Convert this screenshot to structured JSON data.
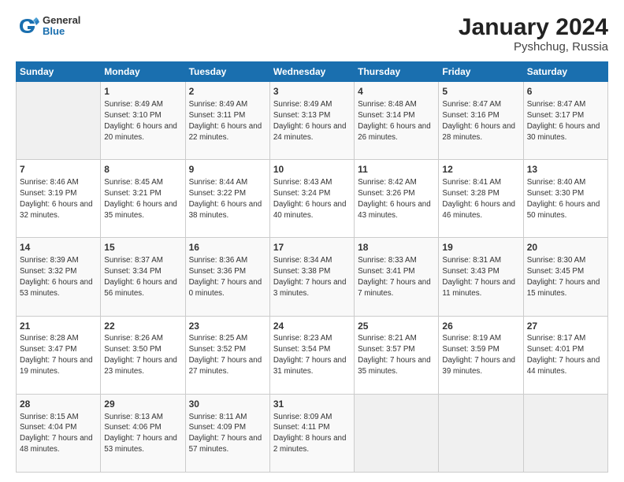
{
  "header": {
    "logo": {
      "line1": "General",
      "line2": "Blue"
    },
    "title": "January 2024",
    "subtitle": "Pyshchug, Russia"
  },
  "weekdays": [
    "Sunday",
    "Monday",
    "Tuesday",
    "Wednesday",
    "Thursday",
    "Friday",
    "Saturday"
  ],
  "weeks": [
    [
      {
        "day": "",
        "sunrise": "",
        "sunset": "",
        "daylight": ""
      },
      {
        "day": "1",
        "sunrise": "Sunrise: 8:49 AM",
        "sunset": "Sunset: 3:10 PM",
        "daylight": "Daylight: 6 hours and 20 minutes."
      },
      {
        "day": "2",
        "sunrise": "Sunrise: 8:49 AM",
        "sunset": "Sunset: 3:11 PM",
        "daylight": "Daylight: 6 hours and 22 minutes."
      },
      {
        "day": "3",
        "sunrise": "Sunrise: 8:49 AM",
        "sunset": "Sunset: 3:13 PM",
        "daylight": "Daylight: 6 hours and 24 minutes."
      },
      {
        "day": "4",
        "sunrise": "Sunrise: 8:48 AM",
        "sunset": "Sunset: 3:14 PM",
        "daylight": "Daylight: 6 hours and 26 minutes."
      },
      {
        "day": "5",
        "sunrise": "Sunrise: 8:47 AM",
        "sunset": "Sunset: 3:16 PM",
        "daylight": "Daylight: 6 hours and 28 minutes."
      },
      {
        "day": "6",
        "sunrise": "Sunrise: 8:47 AM",
        "sunset": "Sunset: 3:17 PM",
        "daylight": "Daylight: 6 hours and 30 minutes."
      }
    ],
    [
      {
        "day": "7",
        "sunrise": "Sunrise: 8:46 AM",
        "sunset": "Sunset: 3:19 PM",
        "daylight": "Daylight: 6 hours and 32 minutes."
      },
      {
        "day": "8",
        "sunrise": "Sunrise: 8:45 AM",
        "sunset": "Sunset: 3:21 PM",
        "daylight": "Daylight: 6 hours and 35 minutes."
      },
      {
        "day": "9",
        "sunrise": "Sunrise: 8:44 AM",
        "sunset": "Sunset: 3:22 PM",
        "daylight": "Daylight: 6 hours and 38 minutes."
      },
      {
        "day": "10",
        "sunrise": "Sunrise: 8:43 AM",
        "sunset": "Sunset: 3:24 PM",
        "daylight": "Daylight: 6 hours and 40 minutes."
      },
      {
        "day": "11",
        "sunrise": "Sunrise: 8:42 AM",
        "sunset": "Sunset: 3:26 PM",
        "daylight": "Daylight: 6 hours and 43 minutes."
      },
      {
        "day": "12",
        "sunrise": "Sunrise: 8:41 AM",
        "sunset": "Sunset: 3:28 PM",
        "daylight": "Daylight: 6 hours and 46 minutes."
      },
      {
        "day": "13",
        "sunrise": "Sunrise: 8:40 AM",
        "sunset": "Sunset: 3:30 PM",
        "daylight": "Daylight: 6 hours and 50 minutes."
      }
    ],
    [
      {
        "day": "14",
        "sunrise": "Sunrise: 8:39 AM",
        "sunset": "Sunset: 3:32 PM",
        "daylight": "Daylight: 6 hours and 53 minutes."
      },
      {
        "day": "15",
        "sunrise": "Sunrise: 8:37 AM",
        "sunset": "Sunset: 3:34 PM",
        "daylight": "Daylight: 6 hours and 56 minutes."
      },
      {
        "day": "16",
        "sunrise": "Sunrise: 8:36 AM",
        "sunset": "Sunset: 3:36 PM",
        "daylight": "Daylight: 7 hours and 0 minutes."
      },
      {
        "day": "17",
        "sunrise": "Sunrise: 8:34 AM",
        "sunset": "Sunset: 3:38 PM",
        "daylight": "Daylight: 7 hours and 3 minutes."
      },
      {
        "day": "18",
        "sunrise": "Sunrise: 8:33 AM",
        "sunset": "Sunset: 3:41 PM",
        "daylight": "Daylight: 7 hours and 7 minutes."
      },
      {
        "day": "19",
        "sunrise": "Sunrise: 8:31 AM",
        "sunset": "Sunset: 3:43 PM",
        "daylight": "Daylight: 7 hours and 11 minutes."
      },
      {
        "day": "20",
        "sunrise": "Sunrise: 8:30 AM",
        "sunset": "Sunset: 3:45 PM",
        "daylight": "Daylight: 7 hours and 15 minutes."
      }
    ],
    [
      {
        "day": "21",
        "sunrise": "Sunrise: 8:28 AM",
        "sunset": "Sunset: 3:47 PM",
        "daylight": "Daylight: 7 hours and 19 minutes."
      },
      {
        "day": "22",
        "sunrise": "Sunrise: 8:26 AM",
        "sunset": "Sunset: 3:50 PM",
        "daylight": "Daylight: 7 hours and 23 minutes."
      },
      {
        "day": "23",
        "sunrise": "Sunrise: 8:25 AM",
        "sunset": "Sunset: 3:52 PM",
        "daylight": "Daylight: 7 hours and 27 minutes."
      },
      {
        "day": "24",
        "sunrise": "Sunrise: 8:23 AM",
        "sunset": "Sunset: 3:54 PM",
        "daylight": "Daylight: 7 hours and 31 minutes."
      },
      {
        "day": "25",
        "sunrise": "Sunrise: 8:21 AM",
        "sunset": "Sunset: 3:57 PM",
        "daylight": "Daylight: 7 hours and 35 minutes."
      },
      {
        "day": "26",
        "sunrise": "Sunrise: 8:19 AM",
        "sunset": "Sunset: 3:59 PM",
        "daylight": "Daylight: 7 hours and 39 minutes."
      },
      {
        "day": "27",
        "sunrise": "Sunrise: 8:17 AM",
        "sunset": "Sunset: 4:01 PM",
        "daylight": "Daylight: 7 hours and 44 minutes."
      }
    ],
    [
      {
        "day": "28",
        "sunrise": "Sunrise: 8:15 AM",
        "sunset": "Sunset: 4:04 PM",
        "daylight": "Daylight: 7 hours and 48 minutes."
      },
      {
        "day": "29",
        "sunrise": "Sunrise: 8:13 AM",
        "sunset": "Sunset: 4:06 PM",
        "daylight": "Daylight: 7 hours and 53 minutes."
      },
      {
        "day": "30",
        "sunrise": "Sunrise: 8:11 AM",
        "sunset": "Sunset: 4:09 PM",
        "daylight": "Daylight: 7 hours and 57 minutes."
      },
      {
        "day": "31",
        "sunrise": "Sunrise: 8:09 AM",
        "sunset": "Sunset: 4:11 PM",
        "daylight": "Daylight: 8 hours and 2 minutes."
      },
      {
        "day": "",
        "sunrise": "",
        "sunset": "",
        "daylight": ""
      },
      {
        "day": "",
        "sunrise": "",
        "sunset": "",
        "daylight": ""
      },
      {
        "day": "",
        "sunrise": "",
        "sunset": "",
        "daylight": ""
      }
    ]
  ]
}
